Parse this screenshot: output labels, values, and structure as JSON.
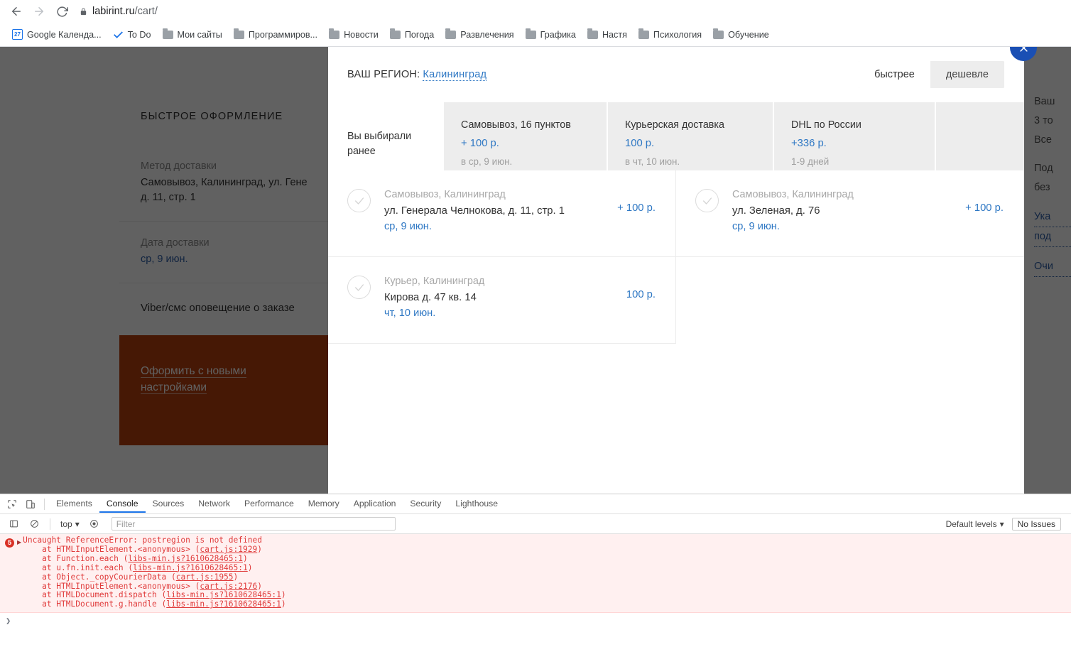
{
  "browser": {
    "back_icon": "back-arrow-icon",
    "forward_icon": "forward-arrow-icon",
    "reload_icon": "reload-icon",
    "lock_icon": "lock-icon",
    "url_host": "labirint.ru",
    "url_path": "/cart/",
    "bookmarks": [
      {
        "label": "Google Календа...",
        "icon": "google-calendar-icon",
        "badge": "27"
      },
      {
        "label": "To Do",
        "icon": "checkmark-icon"
      },
      {
        "label": "Мои сайты",
        "icon": "folder-icon"
      },
      {
        "label": "Программиров...",
        "icon": "folder-icon"
      },
      {
        "label": "Новости",
        "icon": "folder-icon"
      },
      {
        "label": "Погода",
        "icon": "folder-icon"
      },
      {
        "label": "Развлечения",
        "icon": "folder-icon"
      },
      {
        "label": "Графика",
        "icon": "folder-icon"
      },
      {
        "label": "Настя",
        "icon": "folder-icon"
      },
      {
        "label": "Психология",
        "icon": "folder-icon"
      },
      {
        "label": "Обучение",
        "icon": "folder-icon"
      }
    ]
  },
  "cart_page": {
    "section_title": "БЫСТРОЕ ОФОРМЛЕНИЕ",
    "delivery_method_label": "Метод доставки",
    "delivery_method_value": "Самовывоз, Калининград, ул. Гене",
    "delivery_method_value2": "д. 11, стр. 1",
    "delivery_date_label": "Дата доставки",
    "delivery_date_value": "ср, 9 июн.",
    "notice": "Viber/смс оповещение о заказе",
    "cta_line1": "Оформить с новыми",
    "cta_line2": "настройками",
    "cta_color": "#b7410e"
  },
  "right_column": {
    "line1": "Ваш",
    "line2": "3 то",
    "line3": "Все",
    "line4": "Под",
    "line5": "без",
    "link1": "Ука",
    "link2": "под",
    "link3": "Очи"
  },
  "modal": {
    "close_icon": "close-icon",
    "region_label": "ВАШ РЕГИОН:",
    "region_value": "Калининград",
    "sort": {
      "faster_label": "быстрее",
      "cheaper_label": "дешевле",
      "active": "faster"
    },
    "tabs": {
      "first_label_line1": "Вы выбирали",
      "first_label_line2": "ранее",
      "items": [
        {
          "title": "Самовывоз, 16 пунктов",
          "price": "+ 100 р.",
          "eta": "в ср, 9 июн.",
          "selected": true
        },
        {
          "title": "Курьерская доставка",
          "price": "100 р.",
          "eta": "в чт, 10 июн.",
          "selected": false
        },
        {
          "title": "DHL по России",
          "price": "+336 р.",
          "eta": "1-9 дней",
          "selected": false
        }
      ]
    },
    "options": [
      {
        "type": "Самовывоз, Калининград",
        "address": "ул. Генерала Челнокова, д. 11, стр. 1",
        "date": "ср, 9 июн.",
        "price": "+ 100 р.",
        "check_icon": "check-circle-icon"
      },
      {
        "type": "Самовывоз, Калининград",
        "address": "ул. Зеленая, д. 76",
        "date": "ср, 9 июн.",
        "price": "+ 100 р.",
        "check_icon": "check-circle-icon"
      },
      {
        "type": "Курьер, Калининград",
        "address": "Кирова д. 47 кв. 14",
        "date": "чт, 10 июн.",
        "price": "100 р.",
        "check_icon": "check-circle-icon"
      }
    ],
    "accent_color": "#2f78c4"
  },
  "devtools": {
    "inspect_icon": "inspect-element-icon",
    "device_icon": "device-toolbar-icon",
    "tabs": [
      {
        "label": "Elements",
        "active": false
      },
      {
        "label": "Console",
        "active": true
      },
      {
        "label": "Sources",
        "active": false
      },
      {
        "label": "Network",
        "active": false
      },
      {
        "label": "Performance",
        "active": false
      },
      {
        "label": "Memory",
        "active": false
      },
      {
        "label": "Application",
        "active": false
      },
      {
        "label": "Security",
        "active": false
      },
      {
        "label": "Lighthouse",
        "active": false
      }
    ],
    "toolbar": {
      "sidebar_icon": "console-sidebar-icon",
      "clear_icon": "clear-console-icon",
      "context_value": "top",
      "eye_icon": "live-expression-icon",
      "filter_placeholder": "Filter",
      "levels_value": "Default levels",
      "issues_label": "No Issues"
    },
    "console": {
      "error_count": "5",
      "expand_icon": "expand-triangle-icon",
      "message": "Uncaught ReferenceError: postregion is not defined",
      "stack": [
        {
          "pre": "    at HTMLInputElement.<anonymous> (",
          "link": "cart.js:1929",
          "post": ")"
        },
        {
          "pre": "    at Function.each (",
          "link": "libs-min.js?1610628465:1",
          "post": ")"
        },
        {
          "pre": "    at u.fn.init.each (",
          "link": "libs-min.js?1610628465:1",
          "post": ")"
        },
        {
          "pre": "    at Object._copyCourierData (",
          "link": "cart.js:1955",
          "post": ")"
        },
        {
          "pre": "    at HTMLInputElement.<anonymous> (",
          "link": "cart.js:2176",
          "post": ")"
        },
        {
          "pre": "    at HTMLDocument.dispatch (",
          "link": "libs-min.js?1610628465:1",
          "post": ")"
        },
        {
          "pre": "    at HTMLDocument.g.handle (",
          "link": "libs-min.js?1610628465:1",
          "post": ")"
        }
      ],
      "prompt_symbol": "❯"
    }
  }
}
